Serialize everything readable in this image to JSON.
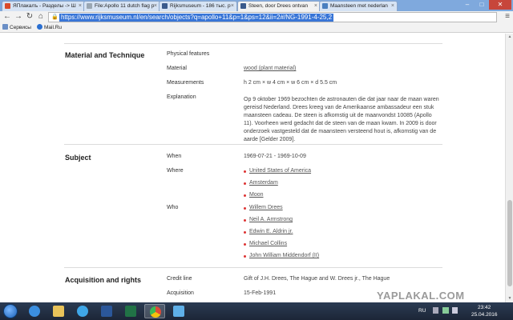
{
  "browser": {
    "tabs": [
      {
        "label": "ЯПлакалъ - Разделы -> Ш",
        "color": "#d94a2a"
      },
      {
        "label": "File:Apollo 11 dutch flag p",
        "color": "#9aa7b3"
      },
      {
        "label": "Rijksmuseum - 186 тыс. р",
        "color": "#3a5a8c"
      },
      {
        "label": "Steen, door Drees ontvan",
        "color": "#3a5a8c"
      },
      {
        "label": "Maansteen met nederlan",
        "color": "#4a7fbf"
      }
    ],
    "url": "https://www.rijksmuseum.nl/en/search/objects?q=apollo+11&p=1&ps=12&ii=2#/NG-1991-4-25,2",
    "bookmarks": [
      {
        "label": "Сервисы",
        "color": "#6b8fc6"
      },
      {
        "label": "Mail.Ru",
        "color": "#2a6fd1"
      }
    ]
  },
  "page": {
    "material_section": {
      "title": "Material and Technique",
      "physical_features_label": "Physical features",
      "material_label": "Material",
      "material_value": "wood (plant material)",
      "measurements_label": "Measurements",
      "measurements_value": "h 2 cm × w 4 cm × w 6 cm × d 5.5 cm",
      "explanation_label": "Explanation",
      "explanation_value": "Op 9 oktober 1969 bezochten de astronauten die dat jaar naar de maan waren gereisd Nederland. Drees kreeg van de Amerikaanse ambassadeur een stuk maansteen cadeau. De steen is afkomstig uit de maanvondst 10085 (Apollo 11). Voorheen werd gedacht dat de steen van de maan kwam. In 2009 is door onderzoek vastgesteld dat de maansteen versteend hout is, afkomstig van de aarde [Gelder 2009]."
    },
    "subject_section": {
      "title": "Subject",
      "when_label": "When",
      "when_value": "1969-07-21 - 1969-10-09",
      "where_label": "Where",
      "where_items": [
        "United States of America",
        "Amsterdam",
        "Moon"
      ],
      "who_label": "Who",
      "who_items": [
        "Willem Drees",
        "Neil A. Armstrong",
        "Edwin E. Aldrin jr.",
        "Michael Collins",
        "John William Middendorf (II)"
      ]
    },
    "acquisition_section": {
      "title": "Acquisition and rights",
      "credit_label": "Credit line",
      "credit_value": "Gift of J.H. Drees, The Hague and W. Drees jr., The Hague",
      "acquisition_label": "Acquisition",
      "acquisition_value": "15-Feb-1991"
    },
    "watermark": "YAPLAKAL.COM"
  },
  "taskbar": {
    "apps": [
      {
        "name": "ie",
        "color": "#3b8fe0"
      },
      {
        "name": "explorer",
        "color": "#e8c35a"
      },
      {
        "name": "media",
        "color": "#3fa7e8"
      },
      {
        "name": "word",
        "color": "#2b579a"
      },
      {
        "name": "excel",
        "color": "#217346"
      },
      {
        "name": "chrome",
        "color": "#dd4b39"
      },
      {
        "name": "paint",
        "color": "#5fb0e8"
      }
    ],
    "lang": "RU",
    "time": "23:42",
    "date": "25.04.2016"
  },
  "colors": {
    "accent": "#3875d7",
    "bullet": "#dd3333"
  }
}
